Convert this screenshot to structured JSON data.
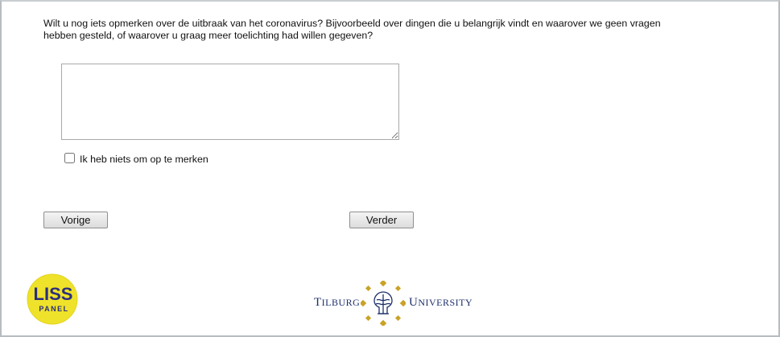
{
  "question": {
    "text": "Wilt u nog iets opmerken over de uitbraak van het coronavirus? Bijvoorbeeld over dingen die u belangrijk vindt en waarover we geen vragen hebben gesteld, of waarover u graag meer toelichting had willen gegeven?"
  },
  "answer": {
    "value": "",
    "placeholder": ""
  },
  "nothing_checkbox": {
    "label": "Ik heb niets om op te merken",
    "checked": false
  },
  "navigation": {
    "prev_label": "Vorige",
    "next_label": "Verder"
  },
  "logos": {
    "liss": {
      "line1": "LISS",
      "line2": "PANEL"
    },
    "tilburg": {
      "left_initial": "T",
      "left_rest": "ILBURG",
      "right_initial": "U",
      "right_rest": "NIVERSITY"
    }
  },
  "colors": {
    "liss_yellow": "#efe22a",
    "liss_text": "#2b2f7e",
    "tilburg_blue": "#1d2f6b",
    "tilburg_gold": "#c9a227"
  }
}
